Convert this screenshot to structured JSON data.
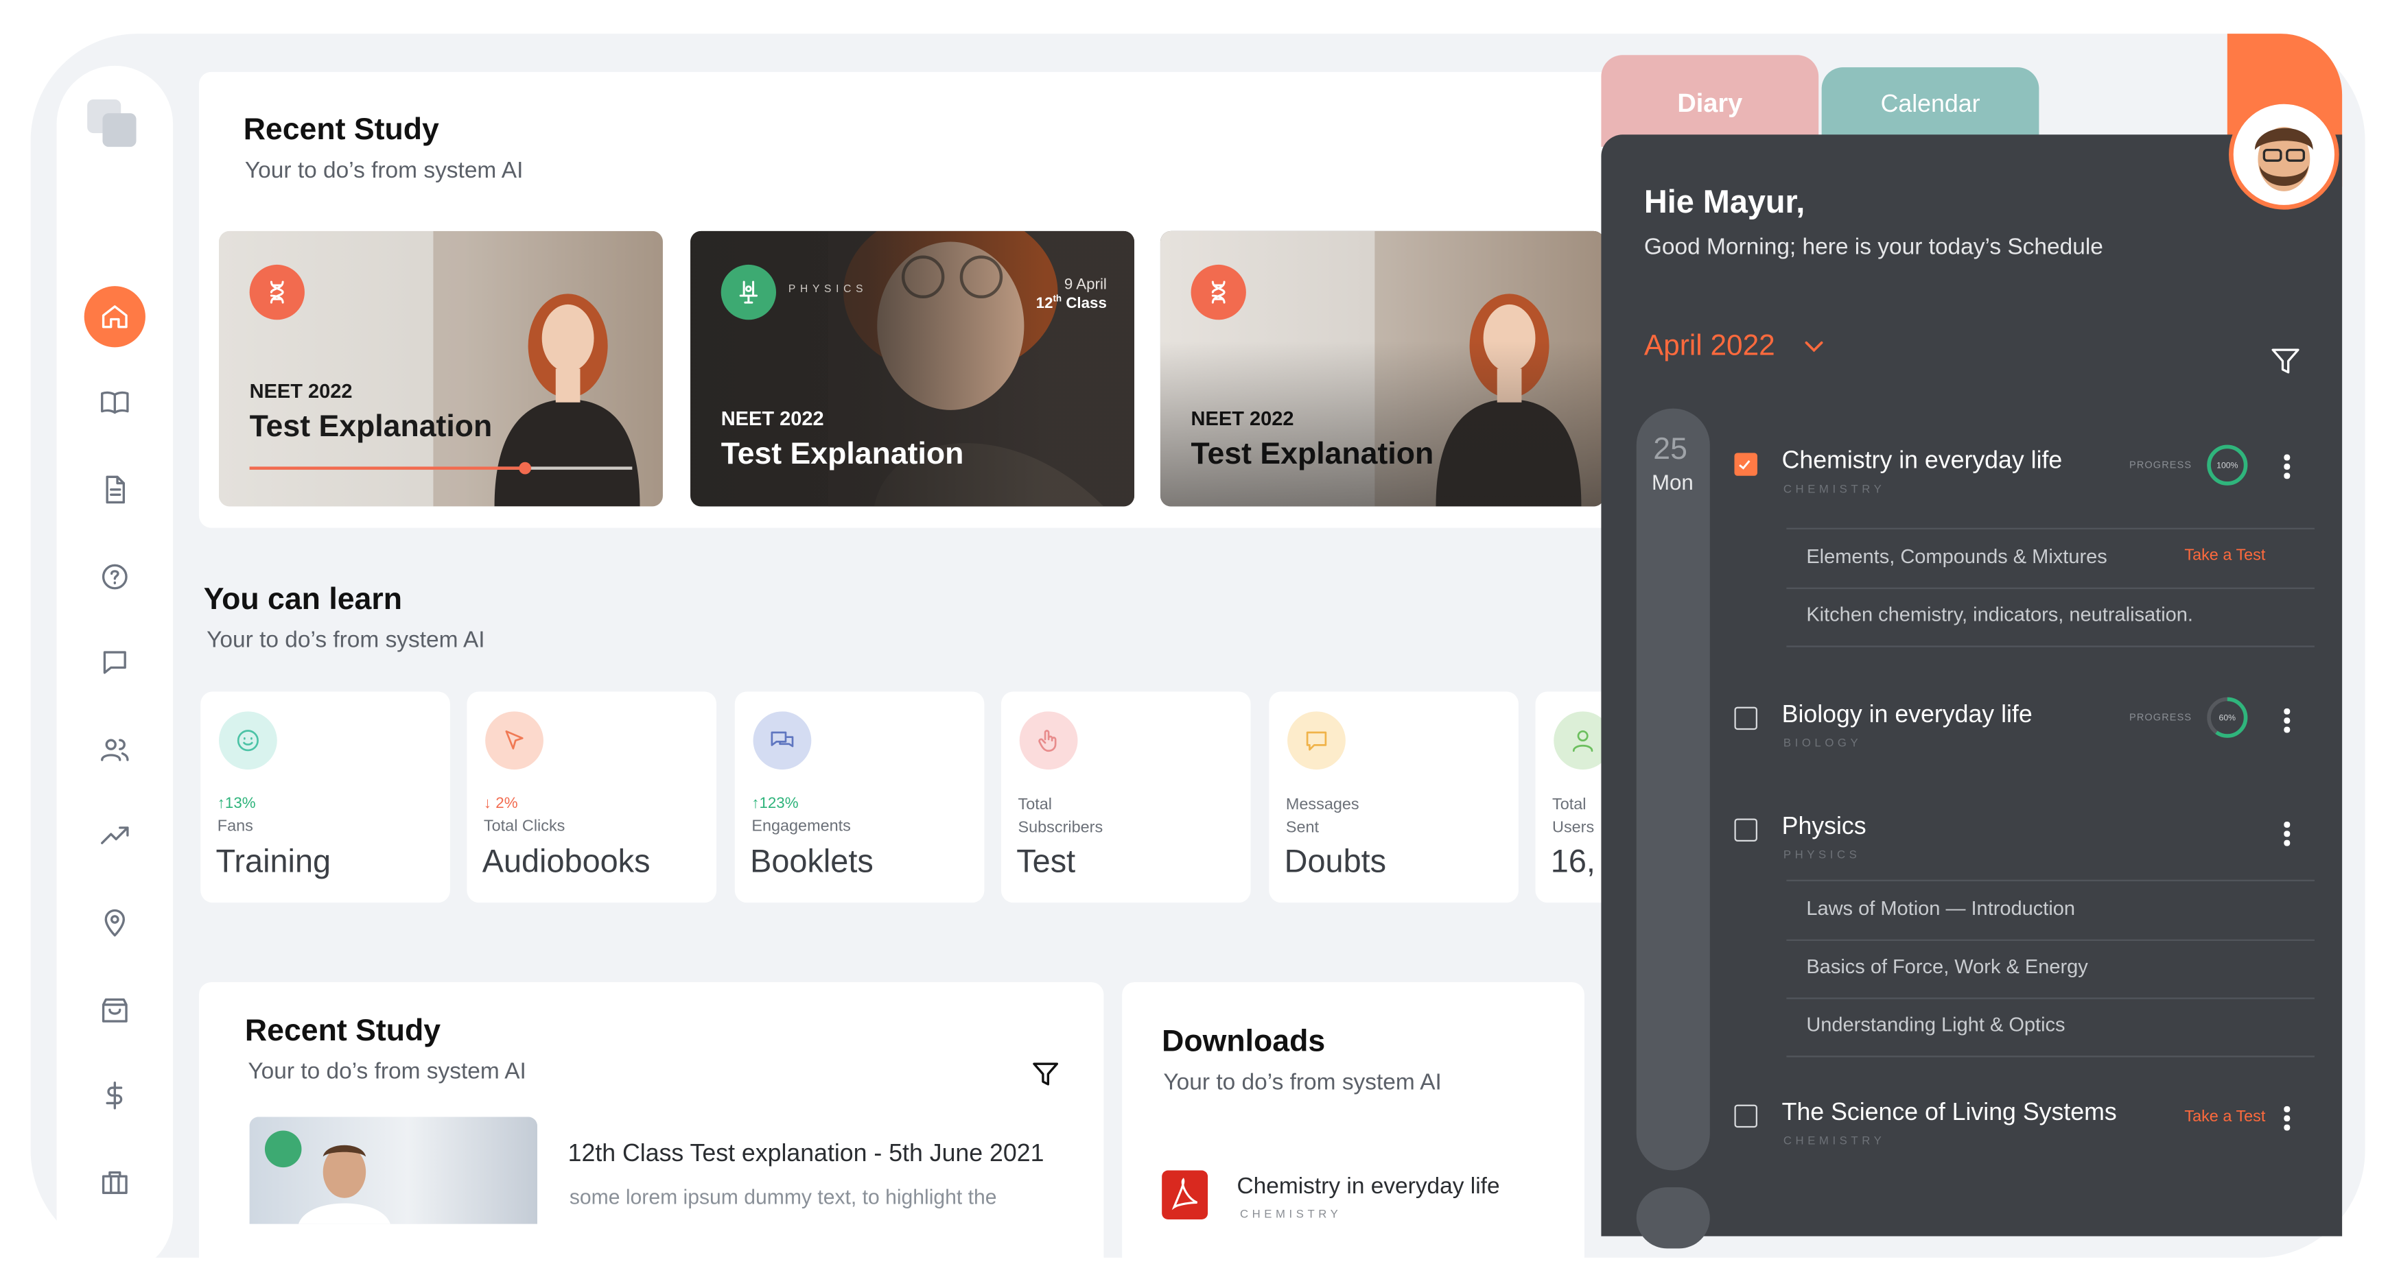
{
  "sidebar": {
    "items": [
      {
        "icon": "home-icon"
      },
      {
        "icon": "book-icon"
      },
      {
        "icon": "document-icon"
      },
      {
        "icon": "question-icon"
      },
      {
        "icon": "chat-icon"
      },
      {
        "icon": "users-icon"
      },
      {
        "icon": "trending-icon"
      },
      {
        "icon": "location-icon"
      },
      {
        "icon": "bag-icon"
      },
      {
        "icon": "dollar-icon"
      },
      {
        "icon": "briefcase-icon"
      }
    ],
    "accent": "#ff7a45"
  },
  "recent_study": {
    "title": "Recent Study",
    "subtitle": "Your to do’s from system AI",
    "cards": [
      {
        "kicker": "NEET 2022",
        "title": "Test Explanation",
        "badge_icon": "dna-icon",
        "badge_color": "#f26b4f",
        "progress": 0.72
      },
      {
        "kicker": "NEET 2022",
        "title": "Test Explanation",
        "badge_icon": "physics-icon",
        "badge_color": "#3daa72",
        "subject": "PHYSICS",
        "date": "9 April",
        "class_label": "12",
        "class_sup": "th",
        "class_suffix": " Class"
      },
      {
        "kicker": "NEET 2022",
        "title": "Test Explanation",
        "badge_icon": "dna-icon",
        "badge_color": "#f26b4f"
      }
    ]
  },
  "learn": {
    "title": "You can learn",
    "subtitle": "Your to do’s from system AI",
    "cards": [
      {
        "delta": "↑13%",
        "delta_color": "#2db37a",
        "small": "Fans",
        "label": "Training",
        "icon": "smile-icon",
        "icon_bg": "#d9f3ee",
        "icon_color": "#4cc3a6"
      },
      {
        "delta": "↓ 2%",
        "delta_color": "#f26b4f",
        "small": "Total Clicks",
        "label": "Audiobooks",
        "icon": "cursor-icon",
        "icon_bg": "#fcd9cc",
        "icon_color": "#f07a55"
      },
      {
        "delta": "↑123%",
        "delta_color": "#2db37a",
        "small": "Engagements",
        "label": "Booklets",
        "icon": "chat-bubbles-icon",
        "icon_bg": "#d4dcf2",
        "icon_color": "#5f76c0"
      },
      {
        "delta": "",
        "delta_color": "#2db37a",
        "small": "Total Subscribers",
        "label": "Test",
        "icon": "touch-icon",
        "icon_bg": "#fbdcdc",
        "icon_color": "#e88c8c"
      },
      {
        "delta": "",
        "delta_color": "#2db37a",
        "small": "Messages Sent",
        "label": "Doubts",
        "icon": "message-icon",
        "icon_bg": "#fdeccb",
        "icon_color": "#f0b34a"
      },
      {
        "delta": "",
        "delta_color": "#2db37a",
        "small": "Total Users",
        "label": "16,",
        "icon": "user-icon",
        "icon_bg": "#dcefd7",
        "icon_color": "#6cbf5e"
      }
    ]
  },
  "recent_study_2": {
    "title": "Recent Study",
    "subtitle": "Your to do’s from system AI",
    "item_title": "12th Class Test explanation - 5th June 2021",
    "item_desc": "some lorem ipsum dummy text, to highlight the"
  },
  "downloads": {
    "title": "Downloads",
    "subtitle": "Your to do’s from system AI",
    "item_title": "Chemistry in everyday life",
    "item_cat": "CHEMISTRY"
  },
  "tabs": {
    "diary": "Diary",
    "calendar": "Calendar"
  },
  "panel": {
    "greeting": "Hie Mayur,",
    "message": "Good Morning; here is your today’s Schedule",
    "month": "April 2022",
    "day_num": "25",
    "day_name": "Mon",
    "progress_label": "PROGRESS",
    "take_test": "Take a Test",
    "schedule": [
      {
        "title": "Chemistry in everyday life",
        "category": "CHEMISTRY",
        "checked": true,
        "progress": "100%",
        "progress_value": 1.0,
        "subtopics": [
          "Elements, Compounds & Mixtures",
          "Kitchen chemistry, indicators, neutralisation."
        ]
      },
      {
        "title": "Biology in everyday life",
        "category": "BIOLOGY",
        "checked": false,
        "progress": "60%",
        "progress_value": 0.6,
        "subtopics": []
      },
      {
        "title": "Physics",
        "category": "PHYSICS",
        "checked": false,
        "subtopics": [
          "Laws of Motion — Introduction",
          "Basics of Force, Work & Energy",
          "Understanding Light & Optics"
        ]
      },
      {
        "title": "The Science of Living Systems",
        "category": "CHEMISTRY",
        "checked": false,
        "subtopics": []
      }
    ]
  }
}
